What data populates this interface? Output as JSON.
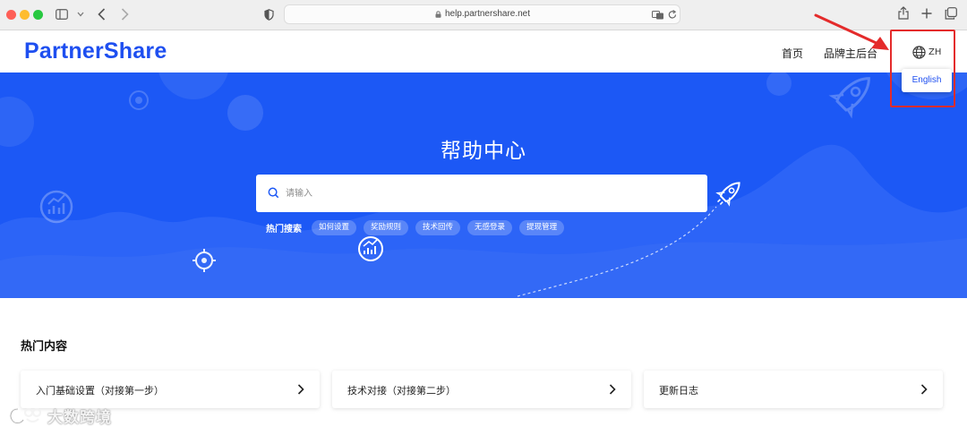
{
  "browser": {
    "url": "help.partnershare.net"
  },
  "header": {
    "logo": "PartnerShare",
    "nav": {
      "home": "首页",
      "console": "品牌主后台"
    },
    "language": {
      "current": "ZH",
      "options": [
        "English"
      ]
    }
  },
  "hero": {
    "title": "帮助中心",
    "search_placeholder": "请输入",
    "hot_search_label": "热门搜索",
    "hot_searches": [
      "如何设置",
      "奖励规则",
      "技术回传",
      "无感登录",
      "提现管理"
    ]
  },
  "hot_content": {
    "title": "热门内容",
    "cards": [
      "入门基础设置（对接第一步）",
      "技术对接（对接第二步）",
      "更新日志"
    ]
  },
  "watermark": {
    "text": "大数跨境"
  },
  "colors": {
    "brand_blue": "#1c58f5",
    "highlight_red": "#e42b2b"
  }
}
